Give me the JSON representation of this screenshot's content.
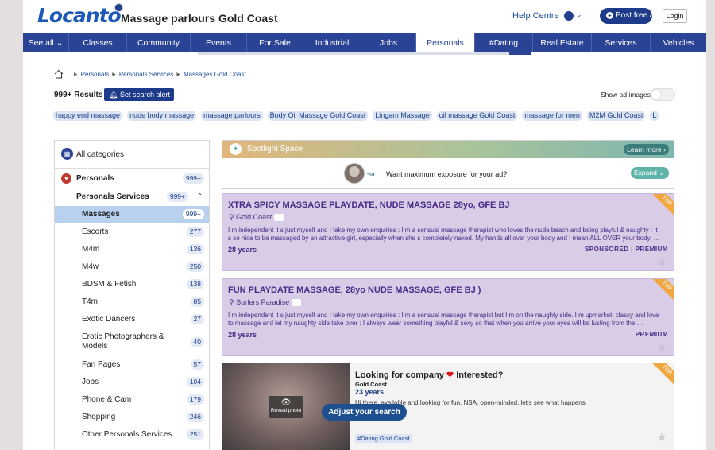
{
  "header": {
    "logo": "Locanto",
    "page_title": "Massage parlours Gold Coast",
    "help": "Help Centre",
    "post": "Post free ad",
    "login": "Login"
  },
  "nav": [
    {
      "label": "See all ⌄",
      "active": false
    },
    {
      "label": "Classes",
      "active": false
    },
    {
      "label": "Community",
      "active": false
    },
    {
      "label": "Events",
      "active": false
    },
    {
      "label": "For Sale",
      "active": false
    },
    {
      "label": "Industrial",
      "active": false
    },
    {
      "label": "Jobs",
      "active": false
    },
    {
      "label": "Personals",
      "active": true
    },
    {
      "label": "#Dating",
      "active": false
    },
    {
      "label": "Real Estate",
      "active": false
    },
    {
      "label": "Services",
      "active": false
    },
    {
      "label": "Vehicles",
      "active": false
    }
  ],
  "breadcrumb": [
    "Personals",
    "Personals Services",
    "Massages Gold Coast"
  ],
  "results": "999+ Results",
  "alert_btn": "Set search alert",
  "show_images": "Show ad images",
  "tags": [
    "happy end massage",
    "nude body massage",
    "massage parlours",
    "Body Oil Massage Gold Coast",
    "Lingam Massage",
    "oil massage Gold Coast",
    "massage for men",
    "M2M Gold Coast",
    "L"
  ],
  "sidebar": {
    "all": "All categories",
    "personals": {
      "label": "Personals",
      "count": "999+"
    },
    "services": {
      "label": "Personals Services",
      "count": "999+"
    },
    "items": [
      {
        "label": "Massages",
        "count": "999+"
      },
      {
        "label": "Escorts",
        "count": "277"
      },
      {
        "label": "M4m",
        "count": "136"
      },
      {
        "label": "M4w",
        "count": "250"
      },
      {
        "label": "BDSM & Fetish",
        "count": "138"
      },
      {
        "label": "T4m",
        "count": "85"
      },
      {
        "label": "Exotic Dancers",
        "count": "27"
      },
      {
        "label": "Erotic Photographers & Models",
        "count": "40"
      },
      {
        "label": "Fan Pages",
        "count": "57"
      },
      {
        "label": "Jobs",
        "count": "104"
      },
      {
        "label": "Phone & Cam",
        "count": "179"
      },
      {
        "label": "Shopping",
        "count": "246"
      },
      {
        "label": "Other Personals Services",
        "count": "251"
      }
    ]
  },
  "spotlight": {
    "title": "Spotlight Space",
    "learn": "Learn more ›",
    "question": "Want maximum exposure for your ad?",
    "expand": "Expand"
  },
  "listings": [
    {
      "title": "XTRA SPICY MASSAGE PLAYDATE, NUDE MASSAGE 28yo, GFE BJ",
      "location": "Gold Coast",
      "desc": "I m independent it s just myself and I take my own enquiries : I m a sensual massage therapist who loves the nude beach and being playful & naughty : It s so nice to be massaged by an attractive girl, especially when she s completely naked. My hands all over your body and I mean ALL OVER your body. …",
      "age": "28 years",
      "badge": "SPONSORED | PREMIUM",
      "ribbon": "TOP"
    },
    {
      "title": "FUN PLAYDATE MASSAGE, 28yo NUDE MASSAGE, GFE BJ )",
      "location": "Surfers Paradise",
      "desc": "I m independent it s just myself and I take my own enquiries : I m a sensual massage therapist but I m on the naughty side. I m upmarket, classy and love to massage and let my naughty side take over : I always wear something playful & sexy so that when you arrive your eyes will be lusting from the …",
      "age": "28 years",
      "badge": "PREMIUM",
      "ribbon": "TOP"
    }
  ],
  "listing3": {
    "title_a": "Looking for company",
    "title_b": "Interested?",
    "location": "Gold Coast",
    "age": "23 years",
    "desc": "Hi there, available and looking for fun, NSA, open-minded, let's see what happens",
    "tag": "#Dating Gold Coast",
    "reveal": "Reveal photo",
    "ribbon": "TOP"
  },
  "adjust": "Adjust your search"
}
